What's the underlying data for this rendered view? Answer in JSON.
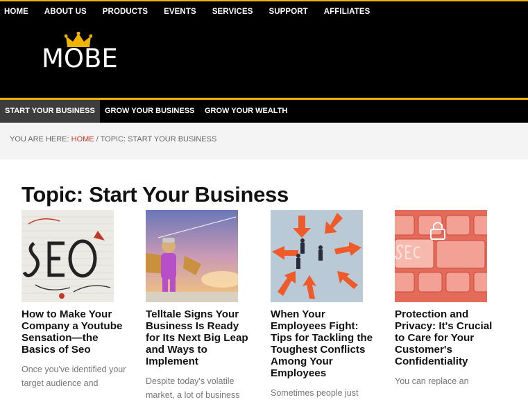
{
  "top_nav": [
    "HOME",
    "ABOUT US",
    "PRODUCTS",
    "EVENTS",
    "SERVICES",
    "SUPPORT",
    "AFFILIATES"
  ],
  "logo": {
    "text": "MOBE"
  },
  "category_nav": [
    {
      "label": "START YOUR BUSINESS",
      "active": true
    },
    {
      "label": "GROW YOUR BUSINESS",
      "active": false
    },
    {
      "label": "GROW YOUR WEALTH",
      "active": false
    }
  ],
  "breadcrumb": {
    "prefix": "YOU ARE HERE:",
    "home": "HOME",
    "separator": "/",
    "current": "TOPIC: START YOUR BUSINESS"
  },
  "page_title": "Topic: Start Your Business",
  "articles": [
    {
      "image": "seo-sketch-image",
      "title": "How to Make Your Company a Youtube Sensation—the Basics of Seo",
      "excerpt": "Once you've identified your target audience and"
    },
    {
      "image": "child-pilot-image",
      "title": "Telltale Signs Your Business Is Ready for Its Next Big Leap and Ways to Implement",
      "excerpt": "Despite today's volatile market, a lot of business"
    },
    {
      "image": "arrows-conflict-image",
      "title": "When Your Employees Fight: Tips for Tackling the Toughest Conflicts Among Your Employees",
      "excerpt": "Sometimes people just"
    },
    {
      "image": "security-keyboard-image",
      "title": "Protection and Privacy: It's Crucial to Care for Your Customer's Confidentiality",
      "excerpt": "You can replace an"
    }
  ],
  "colors": {
    "accent": "#f0b400",
    "link": "#c0392b",
    "header_bg": "#000000"
  }
}
